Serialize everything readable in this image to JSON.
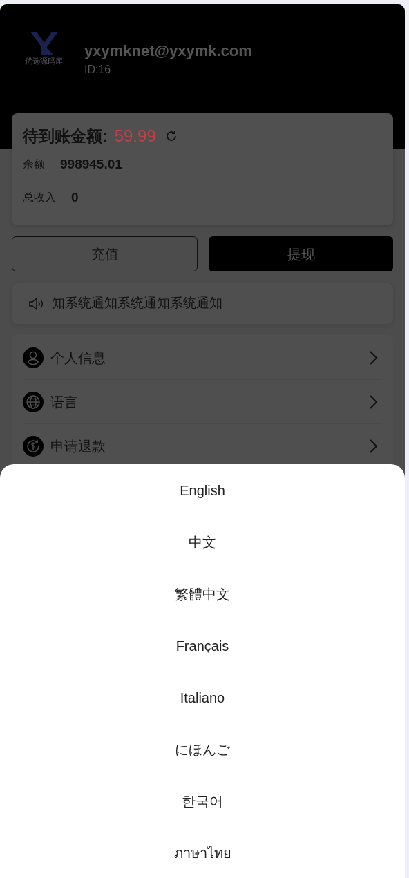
{
  "profile": {
    "logo_text": "优选源码库",
    "email": "yxymknet@yxymk.com",
    "id": "ID:16"
  },
  "balance_card": {
    "pending_label": "待到账金额:",
    "pending_amount": "59.99",
    "rows": [
      {
        "label": "余额",
        "value": "998945.01"
      },
      {
        "label": "总收入",
        "value": "0"
      }
    ]
  },
  "actions": [
    {
      "label": "充值",
      "kind": "outline"
    },
    {
      "label": "提现",
      "kind": "filled"
    }
  ],
  "notice": {
    "text": "知系统通知系统通知系统通知"
  },
  "menu": [
    {
      "label": "个人信息",
      "kind": "person"
    },
    {
      "label": "语言",
      "kind": "globe"
    },
    {
      "label": "申请退款",
      "kind": "refund"
    }
  ],
  "language_sheet": {
    "options": [
      "English",
      "中文",
      "繁體中文",
      "Français",
      "Italiano",
      "にほんご",
      "한국어",
      "ภาษาไทย"
    ]
  }
}
